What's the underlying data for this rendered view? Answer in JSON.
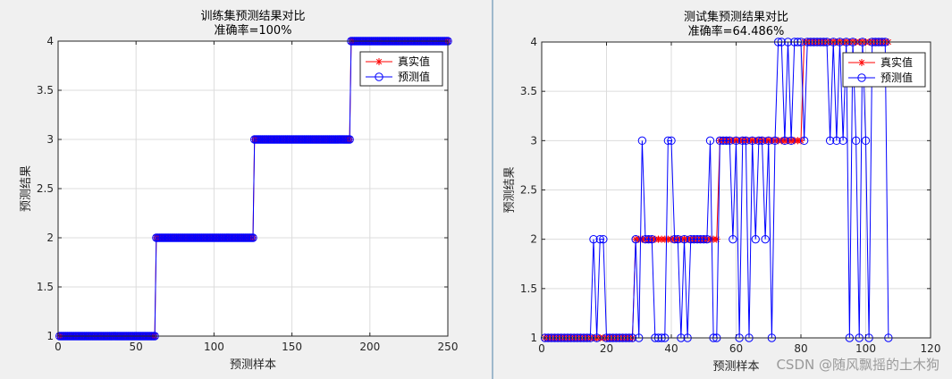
{
  "watermark": "CSDN @随风飘摇的土木狗",
  "chart_data": [
    {
      "type": "line",
      "title": "训练集预测结果对比",
      "subtitle": "准确率=100%",
      "xlabel": "预测样本",
      "ylabel": "预测结果",
      "xlim": [
        0,
        250
      ],
      "ylim": [
        1,
        4
      ],
      "xticks": [
        0,
        50,
        100,
        150,
        200,
        250
      ],
      "yticks": [
        1,
        1.5,
        2,
        2.5,
        3,
        3.5,
        4
      ],
      "grid": true,
      "legend_position": "top-right",
      "series": [
        {
          "name": "真实值",
          "color": "#ff0000",
          "marker": "star",
          "segments": [
            {
              "from": 1,
              "to": 62,
              "value": 1
            },
            {
              "from": 63,
              "to": 125,
              "value": 2
            },
            {
              "from": 126,
              "to": 187,
              "value": 3
            },
            {
              "from": 188,
              "to": 250,
              "value": 4
            }
          ]
        },
        {
          "name": "预测值",
          "color": "#0000ff",
          "marker": "circle",
          "segments": [
            {
              "from": 1,
              "to": 62,
              "value": 1
            },
            {
              "from": 63,
              "to": 125,
              "value": 2
            },
            {
              "from": 126,
              "to": 187,
              "value": 3
            },
            {
              "from": 188,
              "to": 250,
              "value": 4
            }
          ]
        }
      ]
    },
    {
      "type": "line",
      "title": "测试集预测结果对比",
      "subtitle": "准确率=64.486%",
      "xlabel": "预测样本",
      "ylabel": "预测结果",
      "xlim": [
        0,
        120
      ],
      "ylim": [
        1,
        4
      ],
      "xticks": [
        0,
        20,
        40,
        60,
        80,
        100,
        120
      ],
      "yticks": [
        1,
        1.5,
        2,
        2.5,
        3,
        3.5,
        4
      ],
      "grid": true,
      "legend_position": "top-right",
      "series": [
        {
          "name": "真实值",
          "color": "#ff0000",
          "marker": "star",
          "segments": [
            {
              "from": 1,
              "to": 28,
              "value": 1
            },
            {
              "from": 29,
              "to": 54,
              "value": 2
            },
            {
              "from": 55,
              "to": 80,
              "value": 3
            },
            {
              "from": 81,
              "to": 107,
              "value": 4
            }
          ]
        },
        {
          "name": "预测值",
          "color": "#0000ff",
          "marker": "circle",
          "values": [
            1,
            1,
            1,
            1,
            1,
            1,
            1,
            1,
            1,
            1,
            1,
            1,
            1,
            1,
            1,
            2,
            1,
            2,
            2,
            1,
            1,
            1,
            1,
            1,
            1,
            1,
            1,
            1,
            2,
            1,
            3,
            2,
            2,
            2,
            1,
            1,
            1,
            1,
            3,
            3,
            2,
            2,
            1,
            2,
            1,
            2,
            2,
            2,
            2,
            2,
            2,
            3,
            1,
            1,
            3,
            3,
            3,
            3,
            2,
            3,
            1,
            3,
            3,
            1,
            3,
            2,
            3,
            3,
            2,
            3,
            1,
            3,
            4,
            4,
            3,
            4,
            3,
            4,
            4,
            4,
            3,
            4,
            4,
            4,
            4,
            4,
            4,
            4,
            3,
            4,
            3,
            4,
            3,
            4,
            1,
            4,
            3,
            1,
            4,
            3,
            1,
            4,
            4,
            4,
            4,
            4,
            1
          ]
        }
      ]
    }
  ]
}
